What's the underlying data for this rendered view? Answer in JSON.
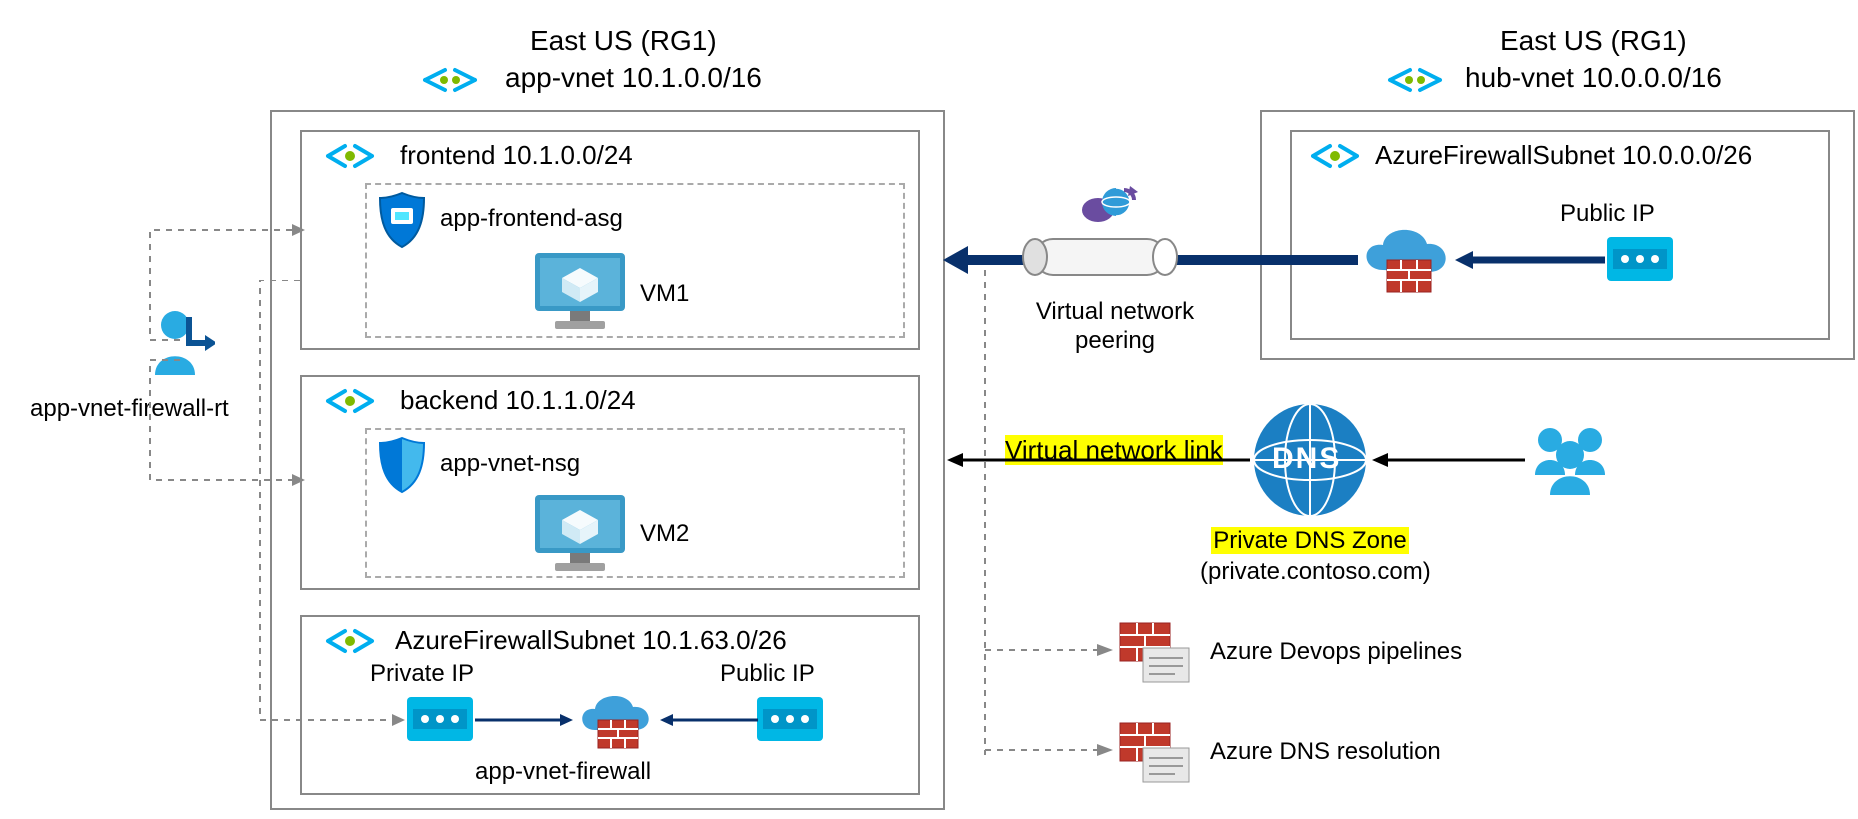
{
  "left": {
    "region": "East US (RG1)",
    "vnet": "app-vnet 10.1.0.0/16",
    "subnets": {
      "frontend": {
        "title": "frontend 10.1.0.0/24",
        "asg": "app-frontend-asg",
        "vm": "VM1"
      },
      "backend": {
        "title": "backend 10.1.1.0/24",
        "nsg": "app-vnet-nsg",
        "vm": "VM2"
      },
      "fw": {
        "title": "AzureFirewallSubnet 10.1.63.0/26",
        "private_ip": "Private IP",
        "public_ip": "Public IP",
        "name": "app-vnet-firewall"
      }
    },
    "rt": "app-vnet-firewall-rt"
  },
  "right": {
    "region": "East US (RG1)",
    "vnet": "hub-vnet 10.0.0.0/16",
    "subnet": {
      "title": "AzureFirewallSubnet 10.0.0.0/26",
      "public_ip": "Public IP"
    }
  },
  "center": {
    "peering": "Virtual network peering",
    "vnet_link": "Virtual network link",
    "dns": "DNS",
    "dns_zone_l1": "Private DNS Zone",
    "dns_zone_l2": "(private.contoso.com)",
    "devops": "Azure Devops pipelines",
    "dns_res": "Azure DNS resolution"
  }
}
